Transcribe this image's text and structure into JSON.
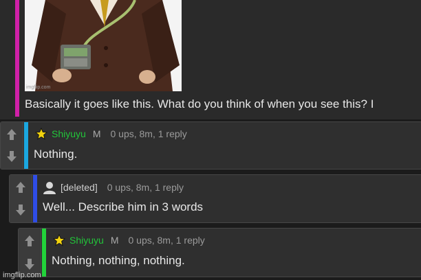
{
  "post": {
    "caption": "Basically it goes like this. What do you think of when you see this? I"
  },
  "comments": [
    {
      "user": "Shiyuyu",
      "gender": "M",
      "meta": "0 ups, 8m, 1 reply",
      "text": "Nothing.",
      "bar_color": "#1ba7e0"
    },
    {
      "user": "[deleted]",
      "meta": "0 ups, 8m, 1 reply",
      "text": "Well... Describe him in 3 words",
      "bar_color": "#2f4de6"
    },
    {
      "user": "Shiyuyu",
      "gender": "M",
      "meta": "0 ups, 8m, 1 reply",
      "text": "Nothing, nothing, nothing.",
      "bar_color": "#22d33a"
    }
  ],
  "watermark": "imgflip.com",
  "colors": {
    "post_bar": "#d020a8",
    "username": "#22c53a"
  }
}
